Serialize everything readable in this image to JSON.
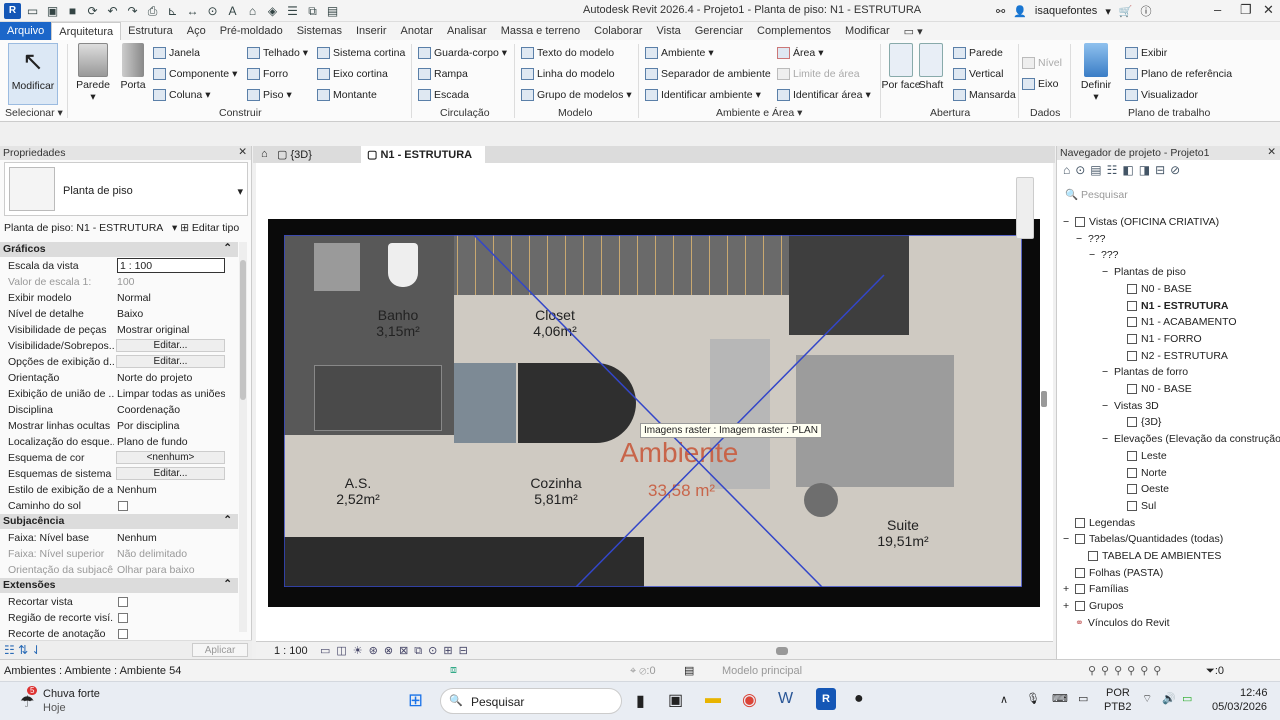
{
  "title": "Autodesk Revit 2026.4 - Projeto1 - Planta de piso: N1 - ESTRUTURA",
  "user": "isaquefontes",
  "menu": [
    "Arquivo",
    "Arquitetura",
    "Estrutura",
    "Aço",
    "Pré-moldado",
    "Sistemas",
    "Inserir",
    "Anotar",
    "Analisar",
    "Massa e terreno",
    "Colaborar",
    "Vista",
    "Gerenciar",
    "Complementos",
    "Modificar"
  ],
  "ribbon": {
    "modificar": "Modificar",
    "selecionar": "Selecionar",
    "parede": "Parede",
    "porta": "Porta",
    "janela": "Janela",
    "componente": "Componente",
    "coluna": "Coluna",
    "telhado": "Telhado",
    "forro": "Forro",
    "piso": "Piso",
    "sistema_cortina": "Sistema  cortina",
    "eixo_cortina": "Eixo  cortina",
    "montante": "Montante",
    "guarda_corpo": "Guarda-corpo",
    "rampa": "Rampa",
    "escada": "Escada",
    "texto_modelo": "Texto do  modelo",
    "linha_modelo": "Linha do  modelo",
    "grupo_modelos": "Grupo de  modelos",
    "ambiente": "Ambiente",
    "separador": "Separador  de ambiente",
    "identificar_ambiente": "Identificar  ambiente",
    "area": "Área",
    "limite_area": "Limite  de área",
    "identificar_area": "Identificar  área",
    "por_face": "Por face",
    "shaft": "Shaft",
    "parede2": "Parede",
    "vertical": "Vertical",
    "mansarda": "Mansarda",
    "nivel": "Nível",
    "eixo": "Eixo",
    "definir": "Definir",
    "exibir": "Exibir",
    "plano_ref": "Plano de  referência",
    "visualizador": "Visualizador",
    "groups": {
      "construir": "Construir",
      "circulacao": "Circulação",
      "modelo": "Modelo",
      "ambiente_area": "Ambiente e Área",
      "abertura": "Abertura",
      "dados": "Dados",
      "plano": "Plano de trabalho"
    }
  },
  "props": {
    "header": "Propriedades",
    "type": "Planta de piso",
    "selector": "Planta de piso: N1 - ESTRUTURA",
    "edit_type": "Editar tipo",
    "apply": "Aplicar",
    "sections": {
      "graficos": "Gráficos",
      "subjacencia": "Subjacência",
      "extensoes": "Extensões"
    },
    "rows": [
      {
        "k": "Escala da vista",
        "v": "1 : 100"
      },
      {
        "k": "Valor de escala    1:",
        "v": "100"
      },
      {
        "k": "Exibir modelo",
        "v": "Normal"
      },
      {
        "k": "Nível de detalhe",
        "v": "Baixo"
      },
      {
        "k": "Visibilidade de peças",
        "v": "Mostrar original"
      },
      {
        "k": "Visibilidade/Sobrepos...",
        "v": "Editar..."
      },
      {
        "k": "Opções de exibição d...",
        "v": "Editar..."
      },
      {
        "k": "Orientação",
        "v": "Norte do projeto"
      },
      {
        "k": "Exibição de união de ...",
        "v": "Limpar todas as uniões..."
      },
      {
        "k": "Disciplina",
        "v": "Coordenação"
      },
      {
        "k": "Mostrar linhas ocultas",
        "v": "Por disciplina"
      },
      {
        "k": "Localização do esque...",
        "v": "Plano de fundo"
      },
      {
        "k": "Esquema de cor",
        "v": "<nenhum>"
      },
      {
        "k": "Esquemas de sistema ...",
        "v": "Editar..."
      },
      {
        "k": "Estilo de exibição de a...",
        "v": "Nenhum"
      },
      {
        "k": "Caminho do sol",
        "v": ""
      },
      {
        "k": "Faixa: Nível base",
        "v": "Nenhum"
      },
      {
        "k": "Faixa: Nível superior",
        "v": "Não delimitado"
      },
      {
        "k": "Orientação da subjacê...",
        "v": "Olhar para baixo"
      },
      {
        "k": "Recortar vista",
        "v": ""
      },
      {
        "k": "Região de recorte visí...",
        "v": ""
      },
      {
        "k": "Recorte de anotação",
        "v": ""
      }
    ]
  },
  "views": {
    "tab3d": "{3D}",
    "tabN1": "N1 - ESTRUTURA"
  },
  "plan": {
    "rooms": [
      {
        "name": "Banho",
        "area": "3,15m²"
      },
      {
        "name": "Closet",
        "area": "4,06m²"
      },
      {
        "name": "A.S.",
        "area": "2,52m²"
      },
      {
        "name": "Cozinha",
        "area": "5,81m²"
      },
      {
        "name": "Suite",
        "area": "19,51m²"
      }
    ],
    "ambiente": "Ambiente",
    "ambiente_area": "33,58 m²",
    "tooltip": "Imagens raster : Imagem raster : PLAN"
  },
  "viewbar": {
    "scale": "1 : 100"
  },
  "nav": {
    "header": "Navegador de projeto - Projeto1",
    "search": "Pesquisar",
    "items": [
      "Vistas (OFICINA CRIATIVA)",
      "???",
      "???",
      "Plantas de piso",
      "N0 - BASE",
      "N1 - ESTRUTURA",
      "N1 - ACABAMENTO",
      "N1 - FORRO",
      "N2 - ESTRUTURA",
      "Plantas de forro",
      "N0 - BASE",
      "Vistas 3D",
      "{3D}",
      "Elevações (Elevação da construção)",
      "Leste",
      "Norte",
      "Oeste",
      "Sul",
      "Legendas",
      "Tabelas/Quantidades (todas)",
      "TABELA DE AMBIENTES",
      "Folhas (PASTA)",
      "Famílias",
      "Grupos",
      "Vínculos do Revit"
    ]
  },
  "status": {
    "left": "Ambientes : Ambiente : Ambiente 54",
    "model": "Modelo principal",
    "zero1": ":0",
    "zero2": ":0"
  },
  "taskbar": {
    "weather": "Chuva forte",
    "weather_sub": "Hoje",
    "weather_badge": "5",
    "search": "Pesquisar",
    "lang": "POR",
    "lang2": "PTB2",
    "time": "12:46",
    "date": "05/03/2026"
  }
}
